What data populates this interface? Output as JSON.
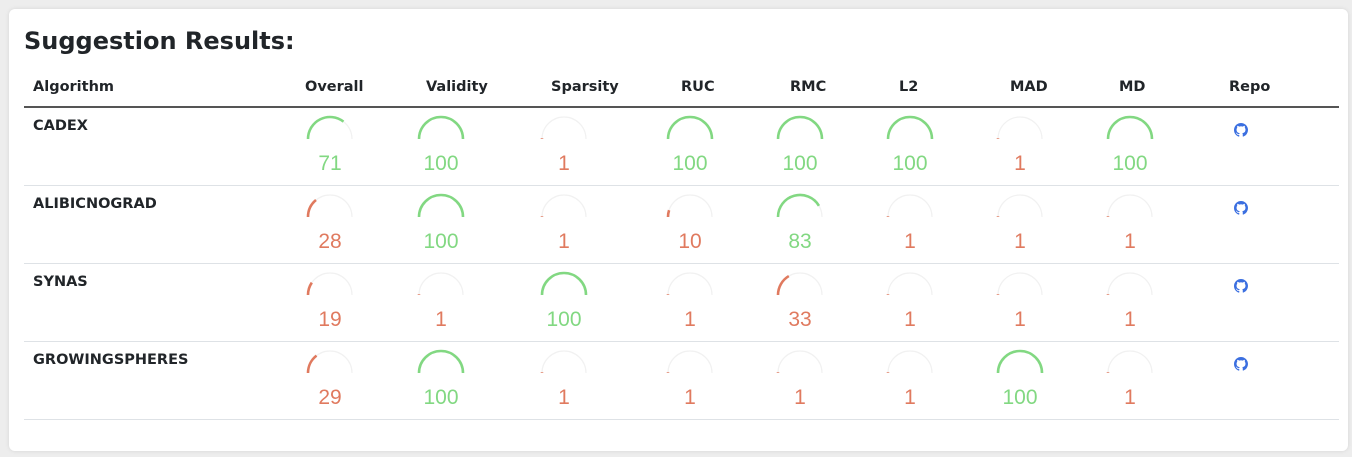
{
  "title": "Suggestion Results:",
  "headers": {
    "algorithm": "Algorithm",
    "overall": "Overall",
    "validity": "Validity",
    "sparsity": "Sparsity",
    "ruc": "RUC",
    "rmc": "RMC",
    "l2": "L2",
    "mad": "MAD",
    "md": "MD",
    "repo": "Repo"
  },
  "metrics": [
    "overall",
    "validity",
    "sparsity",
    "ruc",
    "rmc",
    "l2",
    "mad",
    "md"
  ],
  "colors": {
    "high": "#82d882",
    "low": "#e07a5f",
    "track": "#f1f1f1",
    "repo": "#3b6fe0"
  },
  "rows": [
    {
      "algorithm": "CADEX",
      "values": {
        "overall": "71",
        "validity": "100",
        "sparsity": "1",
        "ruc": "100",
        "rmc": "100",
        "l2": "100",
        "mad": "1",
        "md": "100"
      },
      "repo_icon": "github-icon"
    },
    {
      "algorithm": "ALIBICNOGRAD",
      "values": {
        "overall": "28",
        "validity": "100",
        "sparsity": "1",
        "ruc": "10",
        "rmc": "83",
        "l2": "1",
        "mad": "1",
        "md": "1"
      },
      "repo_icon": "github-icon"
    },
    {
      "algorithm": "SYNAS",
      "values": {
        "overall": "19",
        "validity": "1",
        "sparsity": "100",
        "ruc": "1",
        "rmc": "33",
        "l2": "1",
        "mad": "1",
        "md": "1"
      },
      "repo_icon": "github-icon"
    },
    {
      "algorithm": "GROWINGSPHERES",
      "values": {
        "overall": "29",
        "validity": "100",
        "sparsity": "1",
        "ruc": "1",
        "rmc": "1",
        "l2": "1",
        "mad": "100",
        "md": "1"
      },
      "repo_icon": "github-icon"
    }
  ]
}
